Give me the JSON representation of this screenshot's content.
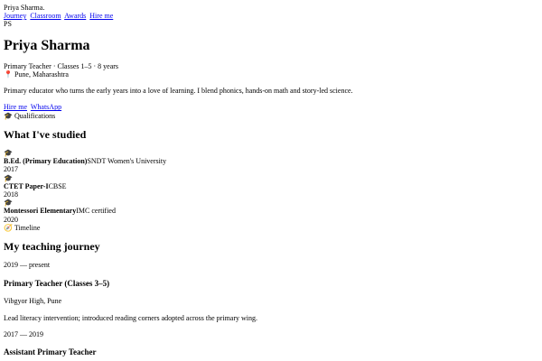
{
  "header": {
    "brand": "Priya Sharma.",
    "nav": [
      "Journey",
      "Classroom",
      "Awards",
      "Hire me"
    ],
    "initials": "PS"
  },
  "hero": {
    "name": "Priya Sharma",
    "meta": "Primary Teacher · Classes 1–5 · 8 years",
    "location_icon": "location-pin-icon",
    "location": "Pune, Maharashtra",
    "bio": "Primary educator who turns the early years into a love of learning. I blend phonics, hands-on math and story-led science.",
    "cta_primary": "Hire me",
    "cta_secondary": "WhatsApp"
  },
  "qualifications": {
    "label_icon": "graduation-cap-icon",
    "label": "Qualifications",
    "heading": "What I've studied",
    "items": [
      {
        "icon": "graduation-cap-icon",
        "title": "B.Ed. (Primary Education)",
        "org": "SNDT Women's University",
        "year": "2017"
      },
      {
        "icon": "graduation-cap-icon",
        "title": "CTET Paper-I",
        "org": "CBSE",
        "year": "2018"
      },
      {
        "icon": "graduation-cap-icon",
        "title": "Montessori Elementary",
        "org": "IMC certified",
        "year": "2020"
      }
    ]
  },
  "timeline": {
    "label_icon": "compass-icon",
    "label": "Timeline",
    "heading": "My teaching journey",
    "entries": [
      {
        "dates": "2019 — present",
        "role": "Primary Teacher (Classes 3–5)",
        "place": "Vibgyor High, Pune",
        "desc": "Lead literacy intervention; introduced reading corners adopted across the primary wing."
      },
      {
        "dates": "2017 — 2019",
        "role": "Assistant Primary Teacher"
      }
    ]
  }
}
